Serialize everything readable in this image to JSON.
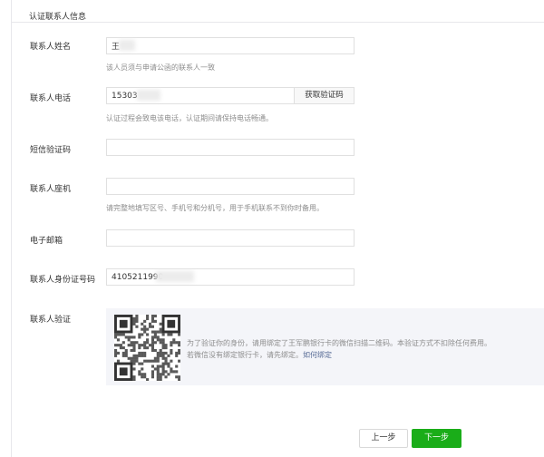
{
  "section": {
    "title": "认证联系人信息"
  },
  "fields": {
    "name": {
      "label": "联系人姓名",
      "value": "王",
      "hint": "该人员须与申请公函的联系人一致"
    },
    "phone": {
      "label": "联系人电话",
      "value": "15303",
      "button": "获取验证码",
      "hint": "认证过程会致电该电话，认证期间请保持电话畅通。"
    },
    "sms": {
      "label": "短信验证码",
      "value": ""
    },
    "landline": {
      "label": "联系人座机",
      "value": "",
      "hint": "请完整地填写区号、手机号和分机号，用于手机联系不到你时备用。"
    },
    "email": {
      "label": "电子邮箱",
      "value": ""
    },
    "idcard": {
      "label": "联系人身份证号码",
      "value": "4105211990"
    }
  },
  "verify": {
    "label": "联系人验证",
    "text1": "为了验证你的身份，请用绑定了王军鹏银行卡的微信扫描二维码。本验证方式不扣除任何费用。",
    "text2_prefix": "若微信没有绑定银行卡，请先绑定。",
    "link": "如何绑定"
  },
  "footer": {
    "prev": "上一步",
    "next": "下一步"
  },
  "colors": {
    "primary": "#1aad19",
    "link": "#576b95"
  }
}
